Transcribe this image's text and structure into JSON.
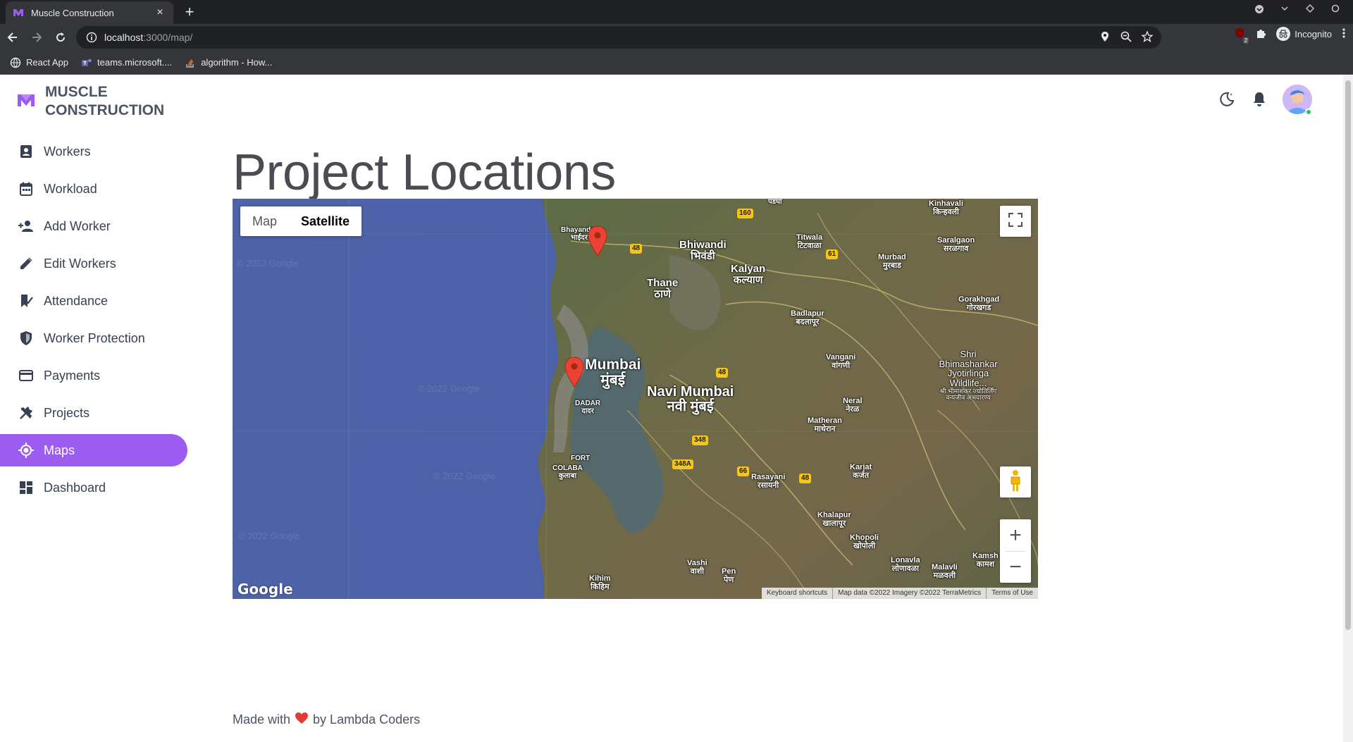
{
  "browser": {
    "tab_title": "Muscle Construction",
    "tab_close": "×",
    "new_tab": "+",
    "url_host": "localhost",
    "url_path": ":3000/map/",
    "profile_label": "Incognito",
    "extension_badge": "2",
    "bookmarks": [
      {
        "label": "React App",
        "icon": "react-icon"
      },
      {
        "label": "teams.microsoft....",
        "icon": "teams-icon"
      },
      {
        "label": "algorithm - How...",
        "icon": "stackoverflow-icon"
      }
    ]
  },
  "brand": {
    "line1": "MUSCLE",
    "line2": "CONSTRUCTION",
    "accent": "#9d5cf0"
  },
  "sidebar": {
    "items": [
      {
        "label": "Workers",
        "icon": "worker-badge-icon",
        "active": false
      },
      {
        "label": "Workload",
        "icon": "calendar-icon",
        "active": false
      },
      {
        "label": "Add Worker",
        "icon": "person-add-icon",
        "active": false
      },
      {
        "label": "Edit Workers",
        "icon": "pencil-icon",
        "active": false
      },
      {
        "label": "Attendance",
        "icon": "attendance-icon",
        "active": false
      },
      {
        "label": "Worker Protection",
        "icon": "shield-icon",
        "active": false
      },
      {
        "label": "Payments",
        "icon": "card-icon",
        "active": false
      },
      {
        "label": "Projects",
        "icon": "tools-icon",
        "active": false
      },
      {
        "label": "Maps",
        "icon": "location-target-icon",
        "active": true
      },
      {
        "label": "Dashboard",
        "icon": "dashboard-icon",
        "active": false
      }
    ]
  },
  "page": {
    "title": "Project Locations"
  },
  "map": {
    "type_options": [
      "Map",
      "Satellite"
    ],
    "selected_type": "Satellite",
    "zoom_in": "+",
    "zoom_out": "−",
    "google": "Google",
    "watermark": "© 2022 Google",
    "attribution": [
      "Keyboard shortcuts",
      "Map data ©2022 Imagery ©2022 TerraMetrics",
      "Terms of Use"
    ],
    "labels": [
      {
        "text": "Mumbai",
        "sub": "मुंबई"
      },
      {
        "text": "Navi Mumbai",
        "sub": "नवी मुंबई"
      },
      {
        "text": "Bhiwandi",
        "sub": "भिवंडी"
      },
      {
        "text": "Kalyan",
        "sub": "कल्याण"
      },
      {
        "text": "Thane",
        "sub": "ठाणे"
      },
      {
        "text": "Titwala",
        "sub": "टिटवाळा"
      },
      {
        "text": "Murbad",
        "sub": "मुरबाड"
      },
      {
        "text": "Saralgaon",
        "sub": "सरळगाव"
      },
      {
        "text": "Kinhavali",
        "sub": "किन्हवली"
      },
      {
        "text": "Gorakhgad",
        "sub": "गोरखगड"
      },
      {
        "text": "Badlapur",
        "sub": "बदलापूर"
      },
      {
        "text": "Vangani",
        "sub": "वांगणी"
      },
      {
        "text": "Neral",
        "sub": "नेरळ"
      },
      {
        "text": "Matheran",
        "sub": "माथेरान"
      },
      {
        "text": "Karjat",
        "sub": "कर्जत"
      },
      {
        "text": "Rasayani",
        "sub": "रसायनी"
      },
      {
        "text": "Khalapur",
        "sub": "खालापूर"
      },
      {
        "text": "Khopoli",
        "sub": "खोपोली"
      },
      {
        "text": "Lonavla",
        "sub": "लोणावळा"
      },
      {
        "text": "Malavli",
        "sub": "मळवली"
      },
      {
        "text": "Kamsh",
        "sub": "कामश"
      },
      {
        "text": "Vashi",
        "sub": "वाशी"
      },
      {
        "text": "Pen",
        "sub": "पेण"
      },
      {
        "text": "Kihim",
        "sub": "किहिम"
      },
      {
        "text": "DADAR",
        "sub": "दादर"
      },
      {
        "text": "FORT",
        "sub": ""
      },
      {
        "text": "COLABA",
        "sub": "कुलाबा"
      },
      {
        "text": "Shri Bhimashankar Jyotirlinga Wildlife...",
        "sub": "श्री भीमाशंकर ज्योतिर्लिंग वन्यजीव अभयारण्य"
      },
      {
        "text": "Bhayandar",
        "sub": "भाईंदर"
      },
      {
        "text": "पडघा",
        "sub": ""
      }
    ],
    "shields": [
      "160",
      "48",
      "61",
      "48",
      "348",
      "348A",
      "66",
      "48"
    ]
  },
  "footer": {
    "prefix": "Made with",
    "suffix": "by Lambda Coders"
  }
}
